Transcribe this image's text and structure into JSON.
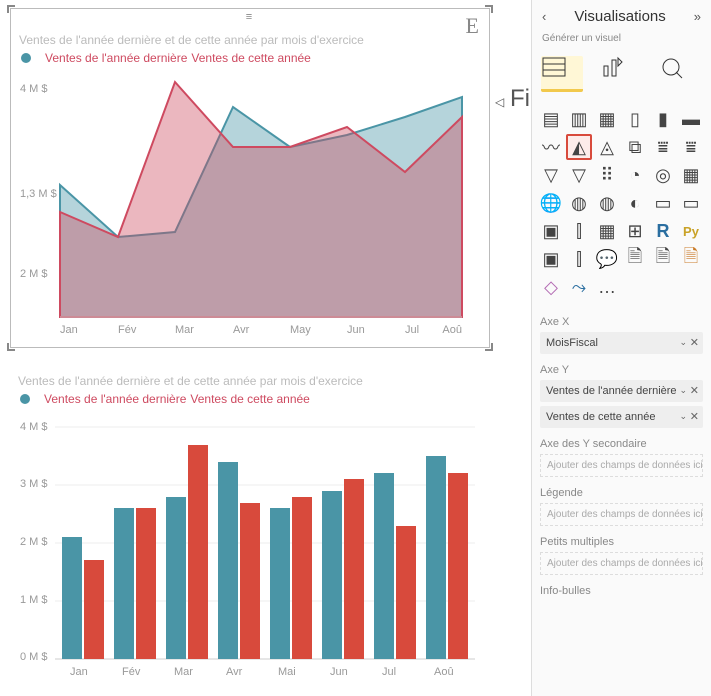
{
  "filters_label": "Filtres",
  "pane": {
    "title": "Visualisations",
    "subtitle": "Générer un visuel",
    "axis_x_label": "Axe X",
    "axis_x_field": "MoisFiscal",
    "axis_y_label": "Axe Y",
    "axis_y_field1": "Ventes de l'année dernière",
    "axis_y_field2": "Ventes de cette année",
    "secondary_y": "Axe des Y secondaire",
    "legend_label": "Légende",
    "small_multiples": "Petits multiples",
    "tooltips": "Info-bulles",
    "placeholder_add": "Ajouter des champs de données ici"
  },
  "chart_top": {
    "title": "Ventes de l'année dernière et de cette année par mois d'exercice",
    "legend1": "Ventes de l'année dernière",
    "legend2": "Ventes de cette année"
  },
  "chart_bottom": {
    "title": "Ventes de l'année dernière et de cette année par mois d'exercice",
    "legend1": "Ventes de l'année dernière",
    "legend2": "Ventes de cette année"
  },
  "yticks": {
    "a": "4 M $",
    "b": "1,3 M $",
    "c": "2 M $",
    "d": "3 M $",
    "e": "1 M $",
    "f": "0 M $"
  },
  "months": {
    "m0": "Jan",
    "m1": "Fév",
    "m2": "Mar",
    "m3": "Avr",
    "m4": "May",
    "m5": "Jun",
    "m6": "Jul",
    "m7": "Aoû",
    "m4b": "Mai"
  },
  "icons": {
    "stacked_bar": "▤",
    "clustered_bar": "▥",
    "stacked_bar2": "▦",
    "column": "▯",
    "column2": "▮",
    "column3": "▬",
    "line": "〰",
    "area": "◭",
    "stacked_area": "◬",
    "ribbon": "⧉",
    "waterfall": "⩸",
    "funnel": "▽",
    "scatter": "⠿",
    "pie": "◔",
    "donut": "◎",
    "treemap": "▦",
    "map": "🌐",
    "filled_map": "◍",
    "gauge": "◐",
    "card": "▭",
    "table": "▦",
    "matrix": "⊞",
    "r": "R",
    "py": "Py",
    "kpi": "▣",
    "slicer": "⫿",
    "comment": "💬",
    "page": "🗎",
    "custom": "◇",
    "flow": "⤳",
    "more": "…"
  },
  "chart_data": [
    {
      "type": "area",
      "title": "Ventes de l'année dernière et de cette année par mois d'exercice",
      "categories": [
        "Jan",
        "Fév",
        "Mar",
        "Avr",
        "Mai",
        "Jun",
        "Jul",
        "Aoû"
      ],
      "series": [
        {
          "name": "Ventes de l'année dernière",
          "color": "#4a95a6",
          "values": [
            2.1,
            1.3,
            1.4,
            3.4,
            2.7,
            2.9,
            3.2,
            3.5
          ]
        },
        {
          "name": "Ventes de cette année",
          "color": "#ce4a60",
          "values": [
            1.7,
            1.3,
            3.8,
            2.7,
            2.7,
            3.1,
            2.3,
            3.2
          ]
        }
      ],
      "ylabel": "M $",
      "ylim": [
        0,
        4.2
      ]
    },
    {
      "type": "bar",
      "title": "Ventes de l'année dernière et de cette année par mois d'exercice",
      "categories": [
        "Jan",
        "Fév",
        "Mar",
        "Avr",
        "Mai",
        "Jun",
        "Jul",
        "Aoû"
      ],
      "series": [
        {
          "name": "Ventes de l'année dernière",
          "color": "#4a95a6",
          "values": [
            2.1,
            2.6,
            2.8,
            3.4,
            2.6,
            2.9,
            3.2,
            3.5
          ]
        },
        {
          "name": "Ventes de cette année",
          "color": "#ce4a60",
          "values": [
            1.7,
            2.6,
            3.7,
            2.7,
            2.8,
            3.1,
            2.3,
            3.2
          ]
        }
      ],
      "ylabel": "M $",
      "ylim": [
        0,
        4
      ]
    }
  ]
}
